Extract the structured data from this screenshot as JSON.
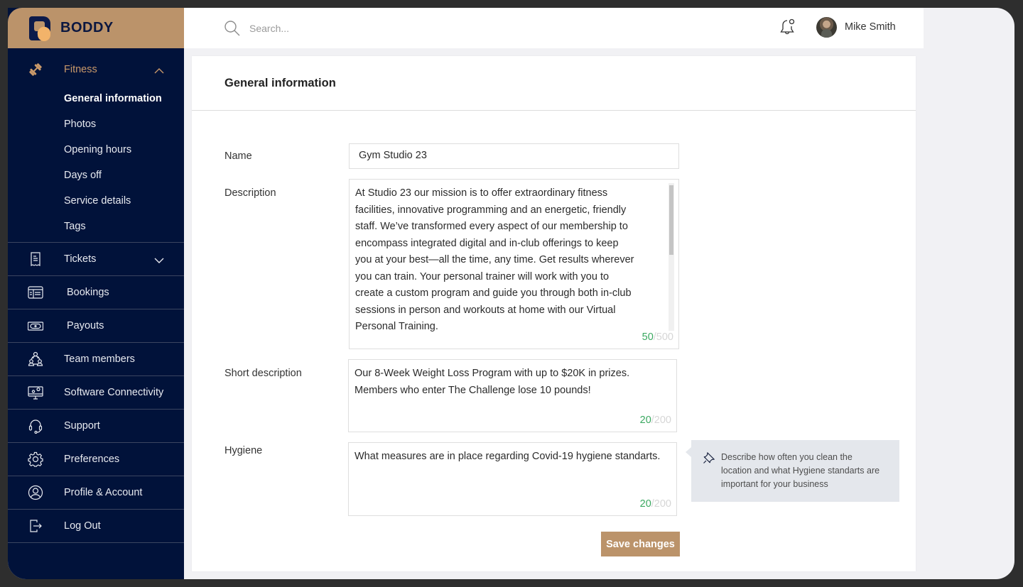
{
  "brand": {
    "name": "BODDY",
    "accent": "#bb936a",
    "navy": "#01123a"
  },
  "topbar": {
    "search_placeholder": "Search...",
    "user_name": "Mike Smith"
  },
  "sidebar": {
    "fitness": {
      "label": "Fitness",
      "expanded": true,
      "sub_items": [
        {
          "label": "General information",
          "current": true
        },
        {
          "label": "Photos"
        },
        {
          "label": "Opening hours"
        },
        {
          "label": "Days off"
        },
        {
          "label": "Service details"
        },
        {
          "label": "Tags"
        }
      ]
    },
    "items": [
      {
        "label": "Tickets",
        "icon": "receipt-icon",
        "has_chevron": true
      },
      {
        "label": "Bookings",
        "icon": "calendar-browser-icon"
      },
      {
        "label": "Payouts",
        "icon": "cash-icon"
      },
      {
        "label": "Team members",
        "icon": "team-icon"
      },
      {
        "label": "Software Connectivity",
        "icon": "monitor-gear-icon"
      },
      {
        "label": "Support",
        "icon": "headset-icon"
      },
      {
        "label": "Preferences",
        "icon": "gear-icon"
      },
      {
        "label": "Profile & Account",
        "icon": "user-circle-icon"
      },
      {
        "label": "Log Out",
        "icon": "logout-icon"
      }
    ]
  },
  "main": {
    "title": "General information",
    "fields": {
      "name": {
        "label": "Name",
        "value": "Gym Studio 23"
      },
      "description": {
        "label": "Description",
        "value": "At Studio 23 our mission is to offer extraordinary fitness facilities, innovative programming and an energetic, friendly staff. We’ve transformed every aspect of our membership to encompass integrated digital and in-club offerings to keep you at your best—all the time, any time. Get results wherever you can train. Your personal trainer will work with you to create a custom program and guide you through both in-club sessions in person and workouts at home with our Virtual Personal Training.",
        "count": "50",
        "max": "/500"
      },
      "short_description": {
        "label": "Short description",
        "value": "Our 8-Week Weight Loss Program with up to $20K in prizes. Members who enter The Challenge lose 10 pounds!",
        "count": "20",
        "max": "/200"
      },
      "hygiene": {
        "label": "Hygiene",
        "value": "What measures are in place regarding Covid-19 hygiene standarts.",
        "count": "20",
        "max": "/200",
        "tip": "Describe how often you clean the location and what Hygiene standarts are important for your business"
      }
    },
    "save_label": "Save changes"
  }
}
